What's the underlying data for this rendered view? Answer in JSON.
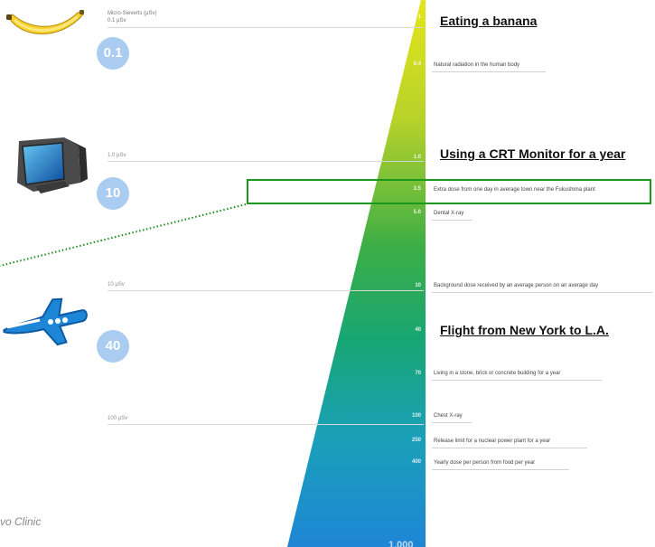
{
  "scale": {
    "header_title": "Micro-Sieverts (µSv)",
    "header_first_value": "0.1 µSv",
    "side_values": [
      "1.0 µSv",
      "10 µSv",
      "100 µSv"
    ]
  },
  "markers": [
    {
      "value": "1",
      "label": ""
    },
    {
      "value": "0.4",
      "label": "Natural radiation in the human body"
    },
    {
      "value": "1.0",
      "label": ""
    },
    {
      "value": "3.5",
      "label": "Extra dose from one day in average town near the Fukushima plant"
    },
    {
      "value": "5.0",
      "label": "Dental X-ray"
    },
    {
      "value": "10",
      "label": "Background dose received by an average person on an average day"
    },
    {
      "value": "40",
      "label": ""
    },
    {
      "value": "70",
      "label": "Living in a stone, brick or concrete building for a year"
    },
    {
      "value": "100",
      "label": "Chest X-ray"
    },
    {
      "value": "250",
      "label": "Release limit for a nuclear power plant for a year"
    },
    {
      "value": "400",
      "label": "Yearly dose per person from food per year"
    }
  ],
  "bottom_value": "1,000",
  "headings": {
    "banana": "Eating a banana",
    "monitor": "Using a CRT Monitor for a year",
    "flight": "Flight from New York to L.A."
  },
  "badges": {
    "banana": "0.1",
    "monitor": "10",
    "flight": "40"
  },
  "credit": "vo Clinic",
  "colors": {
    "wedge_top": "#e4e51a",
    "wedge_mid": "#23a84f",
    "wedge_bottom": "#1f8fd4",
    "highlight": "#199a1f",
    "badge": "#a9ccf0"
  },
  "icons": [
    "banana-icon",
    "crt-monitor-icon",
    "airplane-icon"
  ]
}
